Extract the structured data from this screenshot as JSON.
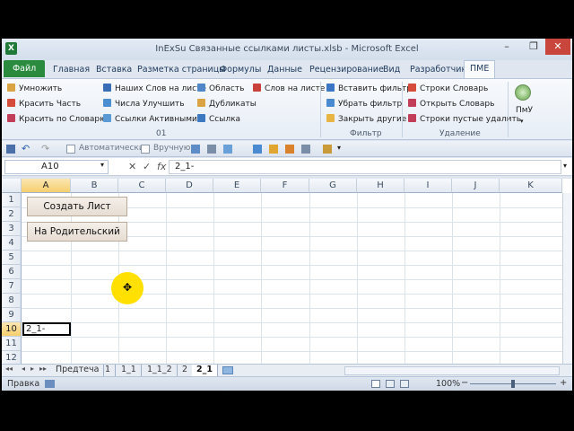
{
  "window": {
    "title": "InExSu Связанные ссылками листы.xlsb - Microsoft Excel",
    "app_icon": "X",
    "minimize": "–",
    "restore": "❐",
    "close": "✕"
  },
  "ribbon_tabs": [
    "Файл",
    "Главная",
    "Вставка",
    "Разметка страницы",
    "Формулы",
    "Данные",
    "Рецензирование",
    "Вид",
    "Разработчик",
    "ПМЕ"
  ],
  "ribbon": {
    "col1": [
      "Умножить",
      "Красить Часть",
      "Красить по Словарю"
    ],
    "col2": [
      "Наших Слов на листе",
      "Числа Улучшить",
      "Ссылки Активными"
    ],
    "col3": [
      "Область",
      "Дубликаты",
      "Ссылка"
    ],
    "col4": [
      "Слов на листе"
    ],
    "group1_label": "01",
    "col5": [
      "Вставить фильтр",
      "Убрать фильтр",
      "Закрыть другие"
    ],
    "group2_label": "Фильтр",
    "col6": [
      "Строки Словарь",
      "Открыть Словарь",
      "Строки пустые удалить"
    ],
    "group3_label": "Удаление",
    "big_button": "ПмУ"
  },
  "qat": {
    "auto_label": "Автоматически",
    "manual_label": "Вручную"
  },
  "formula_bar": {
    "name_box": "A10",
    "fx": "fx",
    "cancel": "✕",
    "confirm": "✓",
    "value": "2_1-"
  },
  "columns": [
    "A",
    "B",
    "C",
    "D",
    "E",
    "F",
    "G",
    "H",
    "I",
    "J",
    "K"
  ],
  "rows": [
    "1",
    "2",
    "3",
    "4",
    "5",
    "6",
    "7",
    "8",
    "9",
    "10",
    "11",
    "12"
  ],
  "buttons": {
    "create_sheet": "Создать Лист",
    "to_parent": "На Родительский"
  },
  "cells": {
    "A10": "2_1-"
  },
  "sheet_tabs": [
    "Предтеча",
    "1",
    "1_1",
    "1_1_2",
    "2",
    "2_1"
  ],
  "active_sheet": "2_1",
  "status": {
    "ready": "Правка",
    "zoom": "100%"
  },
  "colors": {
    "file_tab": "#2a8a3e",
    "selection_header": "#f6cf6d",
    "cursor_highlight": "#ffe000"
  }
}
